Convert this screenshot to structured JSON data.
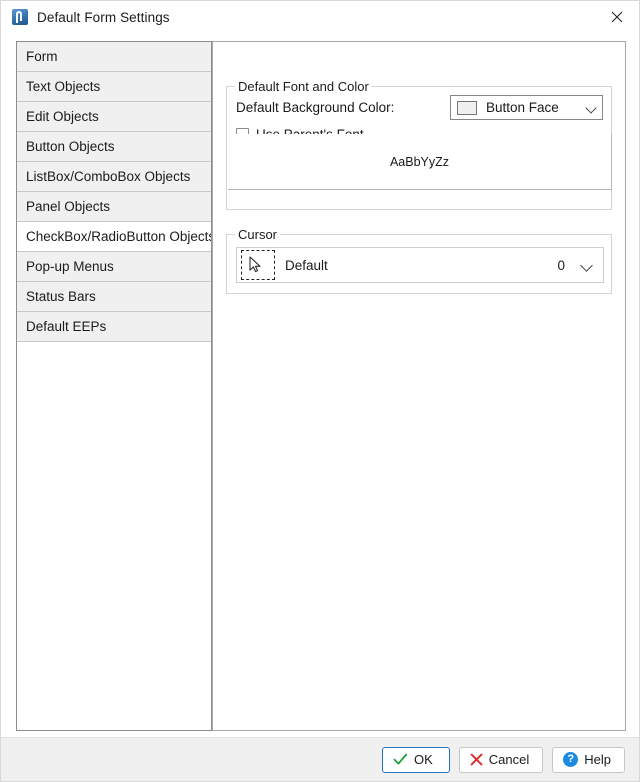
{
  "window": {
    "title": "Default Form Settings",
    "icon": "app-icon",
    "close_label": "✕"
  },
  "sidebar": {
    "items": [
      {
        "label": "Form",
        "state": "selected"
      },
      {
        "label": "Text Objects",
        "state": "normal"
      },
      {
        "label": "Edit Objects",
        "state": "normal"
      },
      {
        "label": "Button Objects",
        "state": "normal"
      },
      {
        "label": "ListBox/ComboBox Objects",
        "state": "normal"
      },
      {
        "label": "Panel Objects",
        "state": "normal"
      },
      {
        "label": "CheckBox/RadioButton Objects",
        "state": "hover"
      },
      {
        "label": "Pop-up Menus",
        "state": "normal"
      },
      {
        "label": "Status Bars",
        "state": "normal"
      },
      {
        "label": "Default EEPs",
        "state": "normal"
      }
    ]
  },
  "font_group": {
    "title": "Default Font and Color",
    "bg_color_label": "Default Background Color:",
    "bg_color_value": "Button Face",
    "bg_color_swatch_hex": "#f0f0f0",
    "use_parents_font_label": "Use Parent's Font",
    "use_parents_font_checked": false,
    "font_sample": "AaBbYyZz"
  },
  "cursor_group": {
    "title": "Cursor",
    "cursor_name": "Default",
    "cursor_index": "0"
  },
  "footer": {
    "ok_label": "OK",
    "cancel_label": "Cancel",
    "help_label": "Help",
    "accent_hex": "#2a73c5",
    "ok_icon_hex": "#1e9e3e",
    "cancel_icon_hex": "#e02a2a",
    "help_icon_hex": "#1b8ae0"
  }
}
